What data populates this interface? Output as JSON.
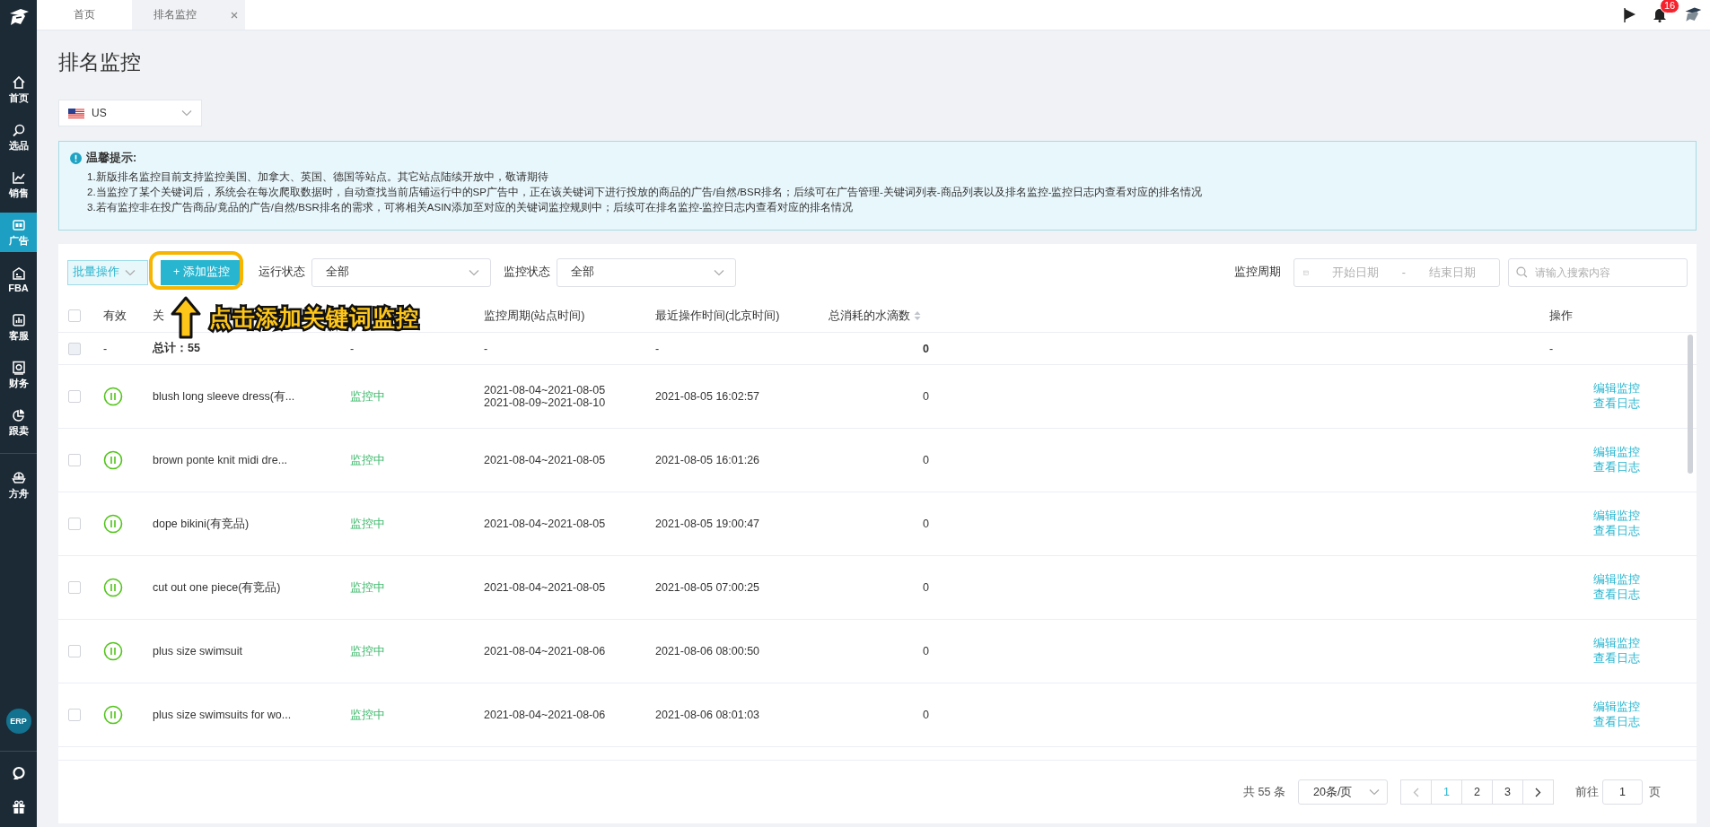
{
  "sidebar": {
    "sections": [
      {
        "items": [
          {
            "label": "首页",
            "selected": false
          },
          {
            "label": "选品",
            "selected": false
          },
          {
            "label": "销售",
            "selected": false
          },
          {
            "label": "广告",
            "selected": true
          },
          {
            "label": "FBA",
            "selected": false
          },
          {
            "label": "客服",
            "selected": false
          },
          {
            "label": "财务",
            "selected": false
          },
          {
            "label": "跟卖",
            "selected": false
          }
        ]
      },
      {
        "items": [
          {
            "label": "方舟",
            "selected": false
          }
        ]
      }
    ],
    "erp_badge": "ERP"
  },
  "tabs": [
    {
      "label": "首页",
      "selected": false,
      "closable": false
    },
    {
      "label": "排名监控",
      "selected": true,
      "closable": true
    }
  ],
  "notification_count": "16",
  "page_title": "排名监控",
  "site_select": {
    "value": "US"
  },
  "notice": {
    "title": "温馨提示:",
    "lines": [
      "1.新版排名监控目前支持监控美国、加拿大、英国、德国等站点。其它站点陆续开放中，敬请期待",
      "2.当监控了某个关键词后，系统会在每次爬取数据时，自动查找当前店铺运行中的SP广告中，正在该关键词下进行投放的商品的广告/自然/BSR排名；后续可在广告管理-关键词列表-商品列表以及排名监控-监控日志内查看对应的排名情况",
      "3.若有监控非在投广告商品/竟品的广告/自然/BSR排名的需求，可将相关ASIN添加至对应的关键词监控规则中；后续可在排名监控-监控日志内查看对应的排名情况"
    ]
  },
  "toolbar": {
    "batch_button": "批量操作",
    "add_button": "+ 添加监控",
    "filters": [
      {
        "label": "运行状态",
        "value": "全部"
      },
      {
        "label": "监控状态",
        "value": "全部"
      }
    ],
    "period": {
      "label": "监控周期",
      "start_placeholder": "开始日期",
      "separator": "-",
      "end_placeholder": "结束日期"
    },
    "search": {
      "placeholder": "请输入搜索内容"
    }
  },
  "table": {
    "header": {
      "select_all_checked": false,
      "valid": "有效",
      "keyword": "关",
      "period": "监控周期(站点时间)",
      "last_op": "最近操作时间(北京时间)",
      "drops": "总消耗的水滴数",
      "drops_sortable": true,
      "actions": "操作"
    },
    "total": {
      "disabled": true,
      "valid": "-",
      "keyword": "总计：55",
      "status": "-",
      "period": "-",
      "last_op": "-",
      "drops": "0",
      "actions": "-"
    },
    "rows": [
      {
        "checked": false,
        "keyword": "blush long sleeve dress(有...",
        "status": "监控中",
        "periods": [
          "2021-08-04~2021-08-05",
          "2021-08-09~2021-08-10"
        ],
        "last_op": "2021-08-05 16:02:57",
        "drops": "0",
        "actions": [
          "编辑监控",
          "查看日志"
        ]
      },
      {
        "checked": false,
        "keyword": "brown ponte knit midi dre...",
        "status": "监控中",
        "periods": [
          "2021-08-04~2021-08-05"
        ],
        "last_op": "2021-08-05 16:01:26",
        "drops": "0",
        "actions": [
          "编辑监控",
          "查看日志"
        ]
      },
      {
        "checked": false,
        "keyword": "dope bikini(有竞品)",
        "status": "监控中",
        "periods": [
          "2021-08-04~2021-08-05"
        ],
        "last_op": "2021-08-05 19:00:47",
        "drops": "0",
        "actions": [
          "编辑监控",
          "查看日志"
        ]
      },
      {
        "checked": false,
        "keyword": "cut out one piece(有竞品)",
        "status": "监控中",
        "periods": [
          "2021-08-04~2021-08-05"
        ],
        "last_op": "2021-08-05 07:00:25",
        "drops": "0",
        "actions": [
          "编辑监控",
          "查看日志"
        ]
      },
      {
        "checked": false,
        "keyword": "plus size swimsuit",
        "status": "监控中",
        "periods": [
          "2021-08-04~2021-08-06"
        ],
        "last_op": "2021-08-06 08:00:50",
        "drops": "0",
        "actions": [
          "编辑监控",
          "查看日志"
        ]
      },
      {
        "checked": false,
        "keyword": "plus size swimsuits for wo...",
        "status": "监控中",
        "periods": [
          "2021-08-04~2021-08-06"
        ],
        "last_op": "2021-08-06 08:01:03",
        "drops": "0",
        "actions": [
          "编辑监控",
          "查看日志"
        ]
      }
    ]
  },
  "pagination": {
    "total": "共 55 条",
    "page_size": "20条/页",
    "pages": [
      {
        "label": "1",
        "selected": true
      },
      {
        "label": "2",
        "selected": false
      },
      {
        "label": "3",
        "selected": false
      }
    ],
    "goto_label": "前往",
    "goto_value": "1",
    "page_unit": "页"
  },
  "guide": {
    "text": "点击添加关键词监控"
  }
}
